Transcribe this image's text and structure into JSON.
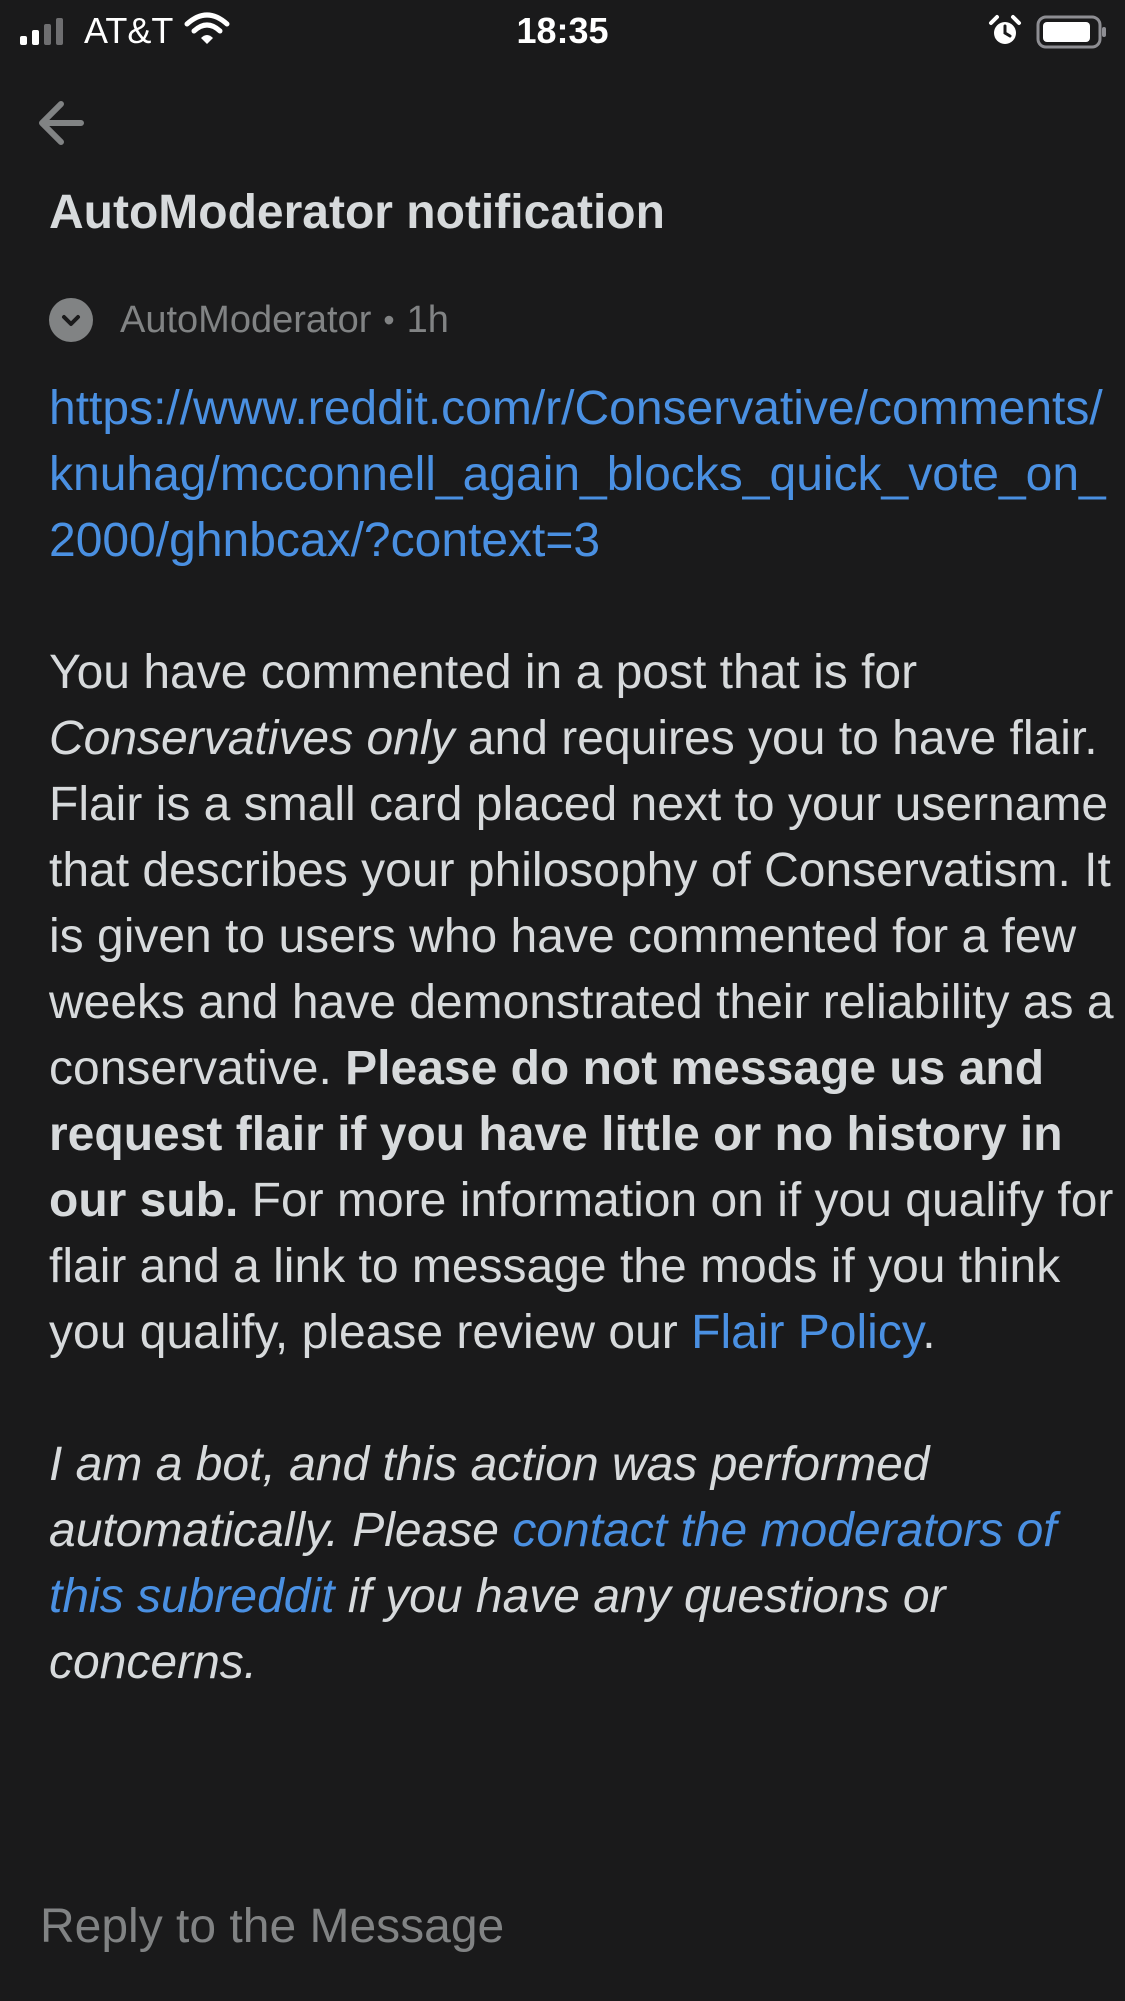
{
  "status_bar": {
    "carrier": "AT&T",
    "time": "18:35"
  },
  "header": {
    "title": "AutoModerator notification"
  },
  "message": {
    "author": "AutoModerator",
    "separator": "•",
    "age": "1h",
    "url": "https://www.reddit.com/r/Conservative/comments/knuhag/mcconnell_again_blocks_quick_vote_on_2000/ghnbcax/?context=3",
    "para1": {
      "t1": "You have commented in a post that is for ",
      "em1": "Conservatives only",
      "t2": " and requires you to have flair.  Flair is a small card placed next to your username that describes your philosophy of Conservatism. It is given to users who have commented for a few weeks and have demonstrated their reliability as a conservative.  ",
      "strong1": "Please do not message us and request flair if you have little or no history in our sub.",
      "t3": "  For more information on if you qualify for flair and a link to message the mods if you think you qualify, please review our ",
      "link1": "Flair Policy",
      "t4": "."
    },
    "para2": {
      "t1": "I am a bot, and this action was performed automatically. Please ",
      "link1": "contact the moderators of this subreddit",
      "t2": " if you have any questions or concerns."
    }
  },
  "reply": {
    "placeholder": "Reply to the Message"
  },
  "icons": {
    "back": "arrow-left-icon",
    "avatar": "chevron-down-icon",
    "wifi": "wifi-icon",
    "alarm": "alarm-icon",
    "battery": "battery-icon",
    "signal": "signal-icon"
  }
}
